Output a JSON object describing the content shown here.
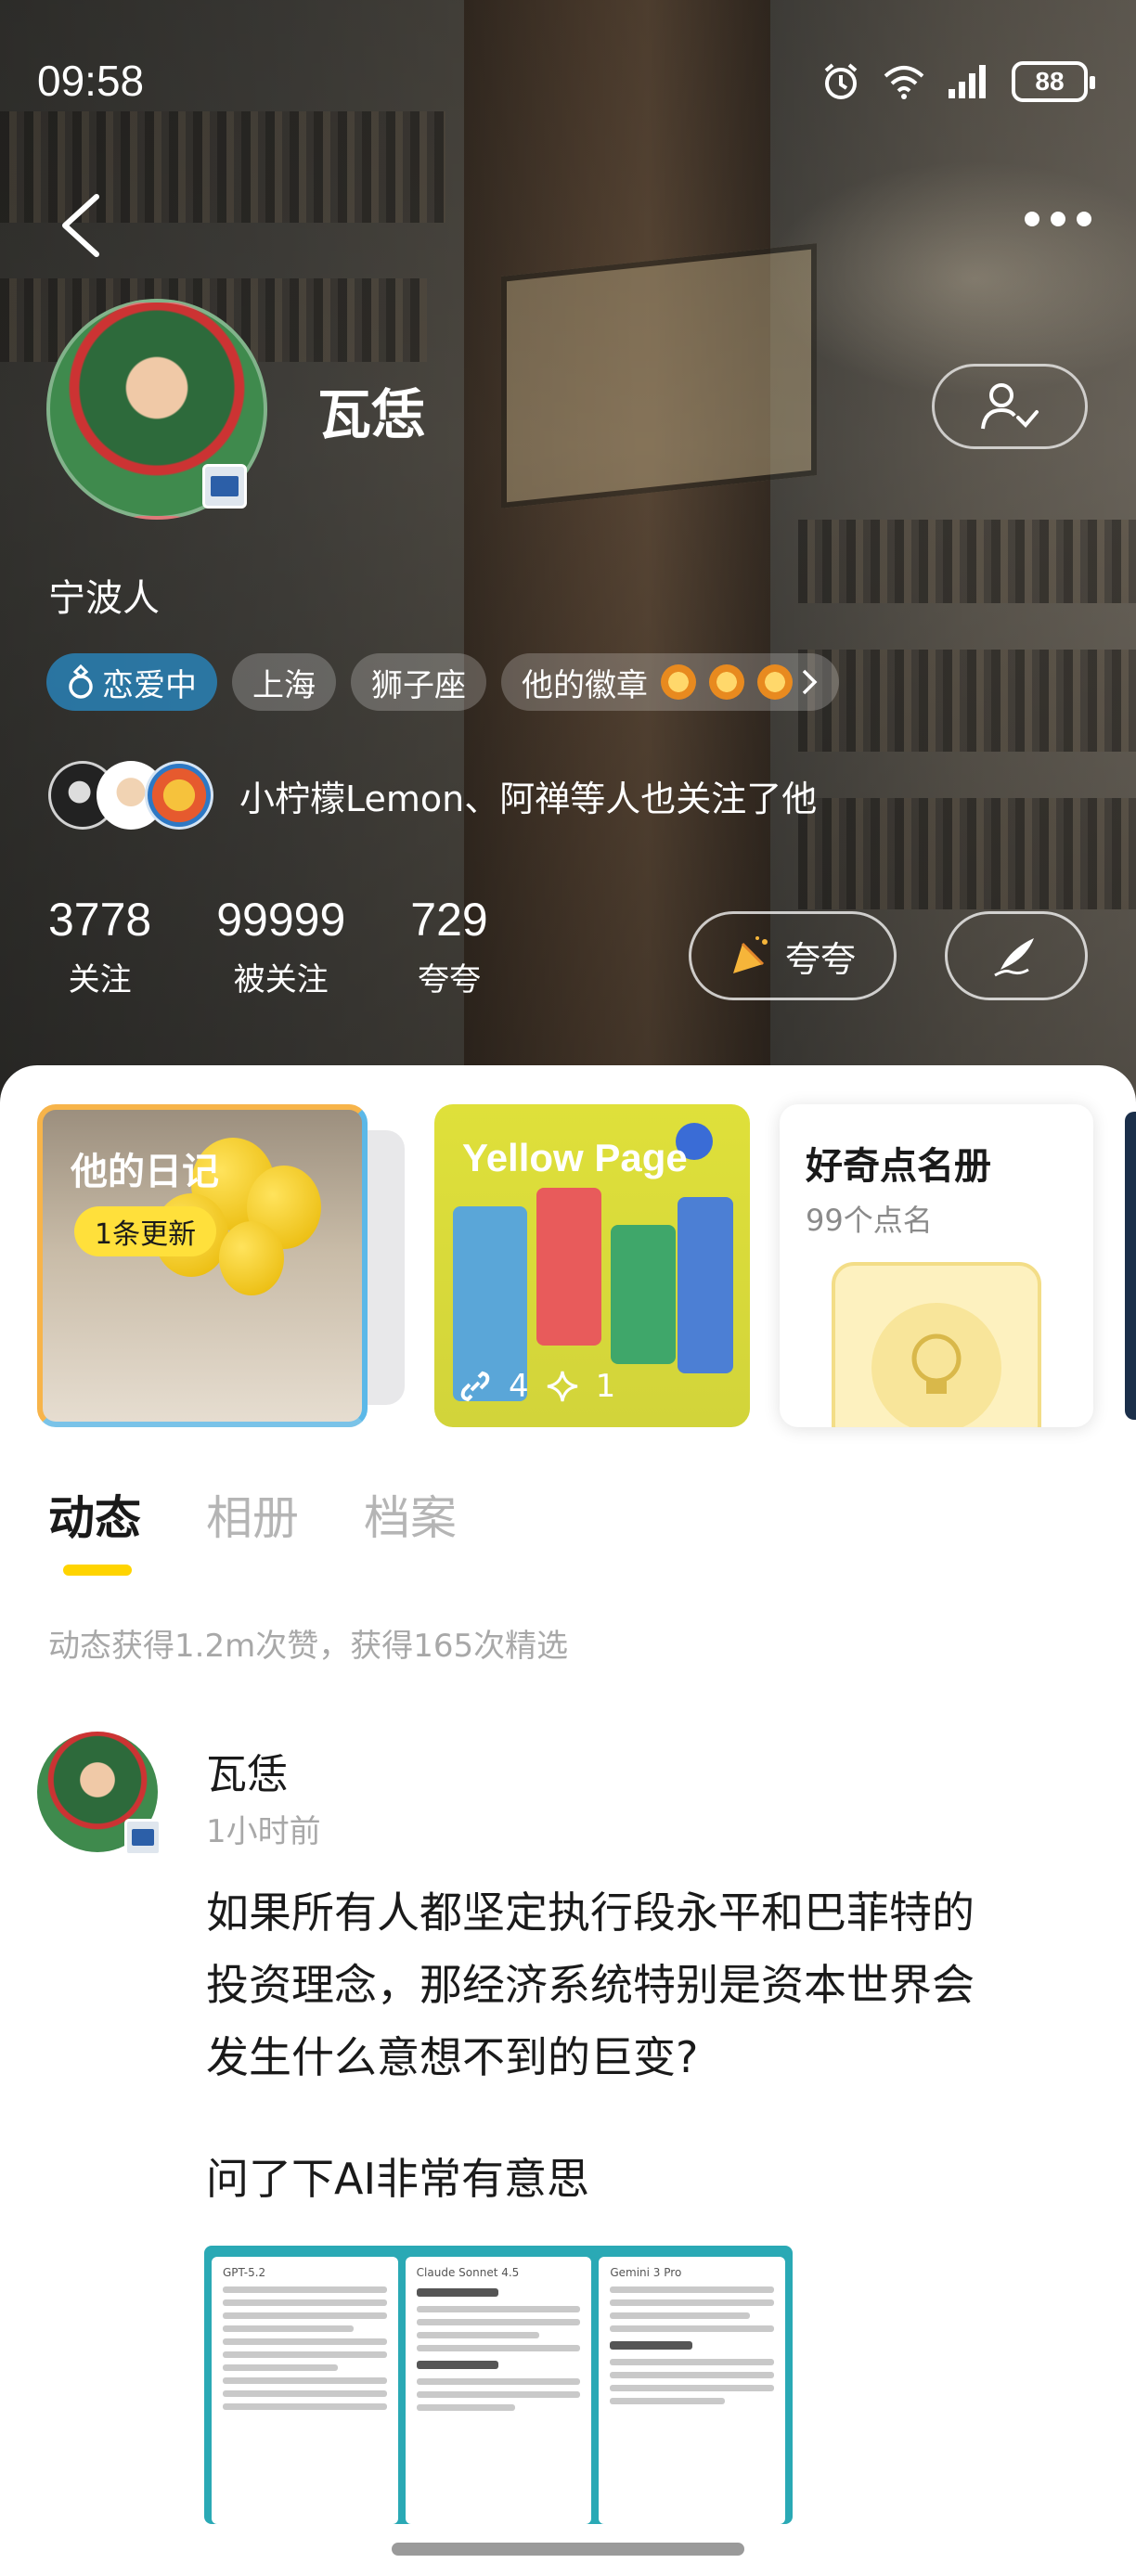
{
  "status_bar": {
    "time": "09:58",
    "battery": "88"
  },
  "profile": {
    "name": "瓦恁",
    "hometown": "宁波人",
    "tags": {
      "relationship": "恋爱中",
      "city": "上海",
      "zodiac": "狮子座",
      "badges": "他的徽章"
    },
    "followed_by": "小柠檬Lemon、阿禅等人也关注了他",
    "stats": {
      "following": {
        "value": "3778",
        "label": "关注"
      },
      "followers": {
        "value": "99999",
        "label": "被关注"
      },
      "praise": {
        "value": "729",
        "label": "夸夸"
      }
    },
    "praise_button": "夸夸"
  },
  "cards": {
    "diary": {
      "title": "他的日记",
      "badge": "1条更新"
    },
    "yellow_page": {
      "title": "Yellow Page",
      "links": "4",
      "sparkles": "1"
    },
    "curious": {
      "title": "好奇点名册",
      "subtitle": "99个点名"
    }
  },
  "tabs": [
    "动态",
    "相册",
    "档案"
  ],
  "summary": "动态获得1.2m次赞，获得165次精选",
  "post": {
    "author": "瓦恁",
    "time": "1小时前",
    "text_line1": "如果所有人都坚定执行段永平和巴菲特的",
    "text_line2": "投资理念，那经济系统特别是资本世界会",
    "text_line3": "发生什么意想不到的巨变?",
    "text_line4": "问了下AI非常有意思",
    "image_panels": [
      "GPT-5.2",
      "Claude Sonnet 4.5",
      "Gemini 3 Pro"
    ]
  },
  "colors": {
    "accent_yellow": "#ffd400",
    "relationship_tag": "#288cc8",
    "diary_border": "#f7b44a"
  }
}
